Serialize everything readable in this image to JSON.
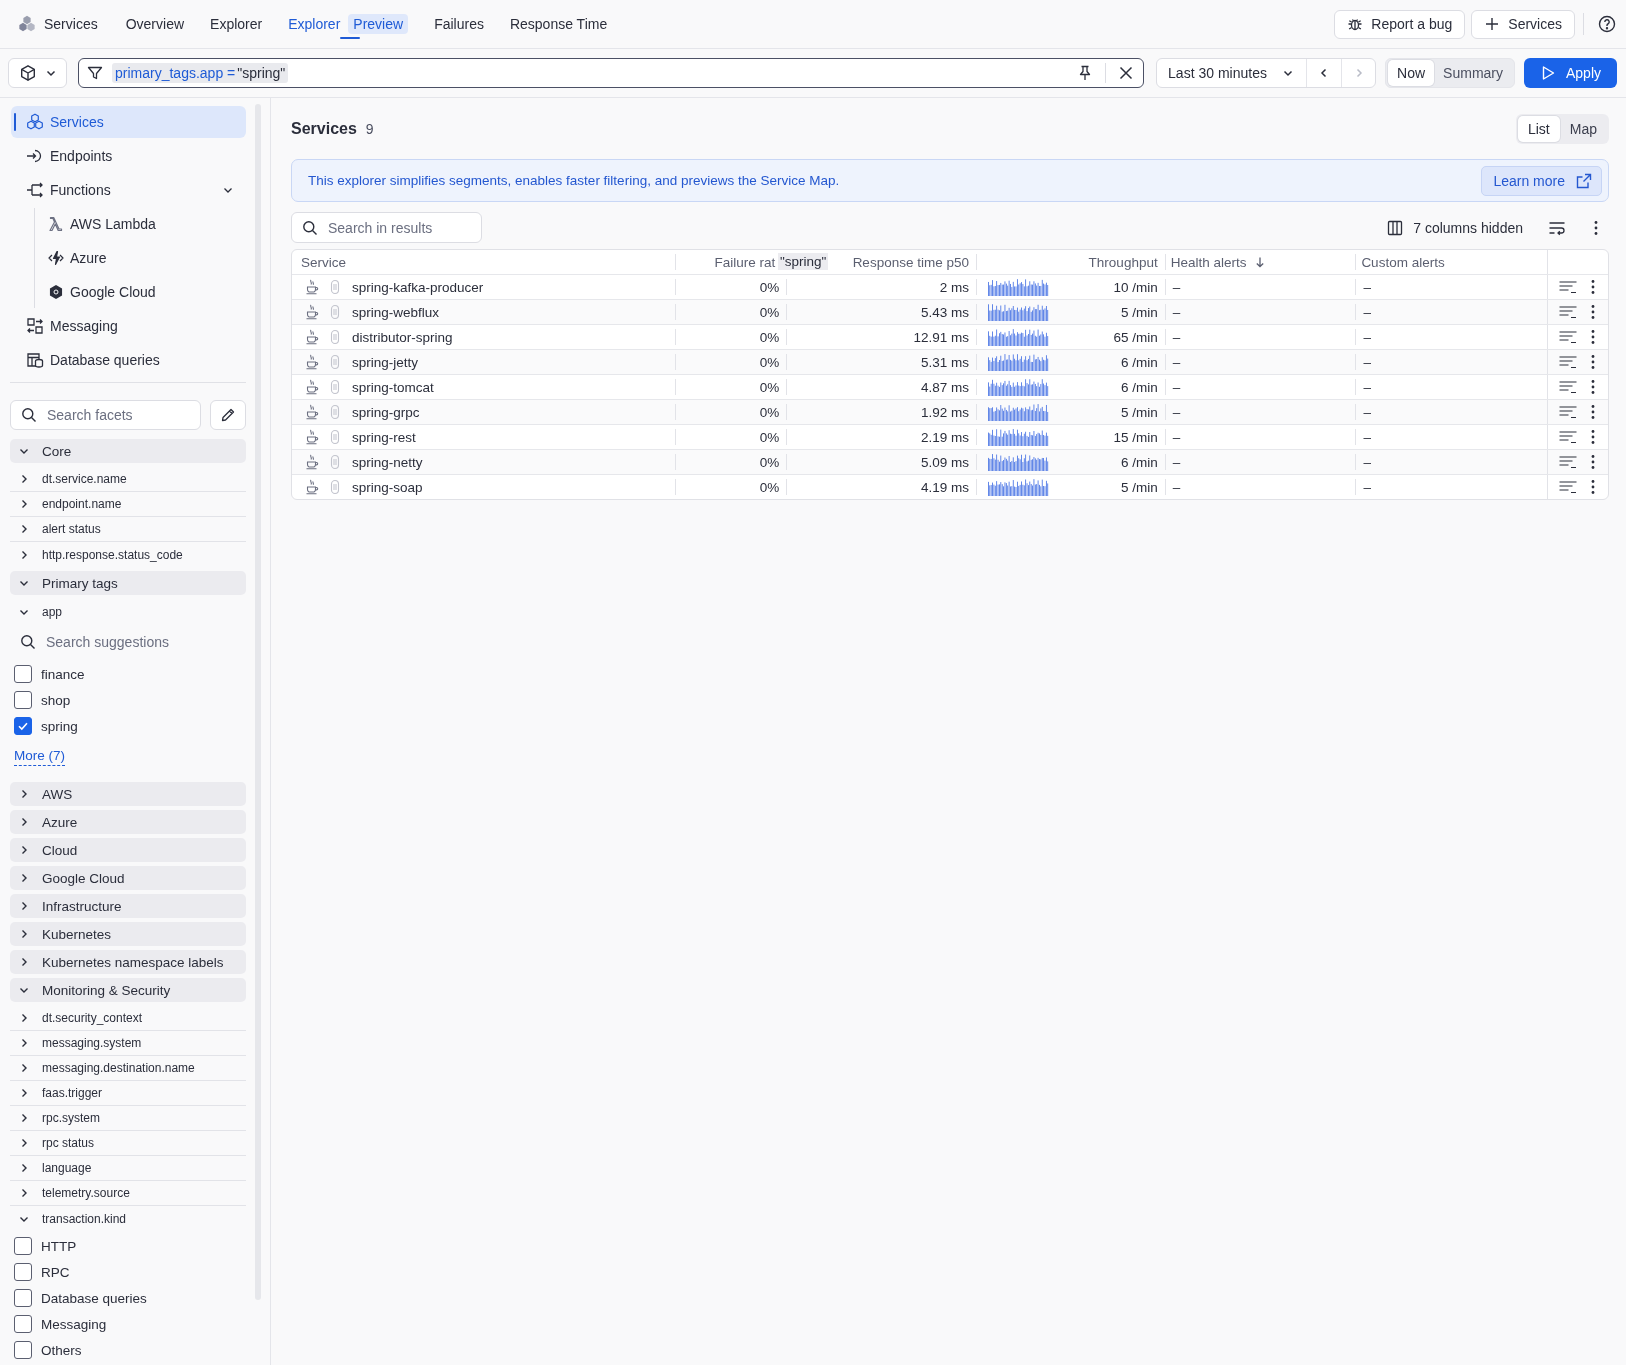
{
  "app_bar": {
    "app_name": "Services",
    "tabs": [
      {
        "label": "Overview",
        "selected": false
      },
      {
        "label": "Explorer",
        "selected": false
      },
      {
        "label": "Explorer",
        "badge": "Preview",
        "selected": true
      },
      {
        "label": "Failures",
        "selected": false
      },
      {
        "label": "Response Time",
        "selected": false
      }
    ],
    "actions": [
      {
        "label": "Report a bug"
      },
      {
        "label": "Services"
      }
    ]
  },
  "toolbar": {
    "filter": {
      "key": "primary_tags.app =",
      "value": "\"spring\""
    },
    "timeframe": "Last 30 minutes",
    "time_steps": [
      {
        "kind": "previous",
        "disabled": false
      },
      {
        "kind": "next",
        "disabled": true
      }
    ],
    "modes": [
      {
        "label": "Now",
        "selected": true
      },
      {
        "label": "Summary",
        "selected": false
      }
    ],
    "apply": "Apply"
  },
  "sidebar": {
    "nav": [
      {
        "label": "Services",
        "selected": true
      },
      {
        "label": "Endpoints",
        "selected": false
      },
      {
        "label": "Functions",
        "selected": false,
        "expanded": true,
        "children": [
          {
            "label": "AWS Lambda",
            "selected": false
          },
          {
            "label": "Azure",
            "selected": false
          },
          {
            "label": "Google Cloud",
            "selected": false
          }
        ]
      },
      {
        "label": "Messaging",
        "selected": false
      },
      {
        "label": "Database queries",
        "selected": false
      }
    ],
    "facet_search": {
      "placeholder": "Search facets"
    },
    "facet_groups": [
      {
        "label": "Core",
        "expanded": true,
        "facets": [
          {
            "label": "dt.service.name",
            "expanded": false
          },
          {
            "label": "endpoint.name",
            "expanded": false
          },
          {
            "label": "alert status",
            "expanded": false
          },
          {
            "label": "http.response.status_code",
            "expanded": false
          }
        ]
      },
      {
        "label": "Primary tags",
        "expanded": true,
        "facets": [
          {
            "label": "app",
            "expanded": true,
            "search": {
              "placeholder": "Search suggestions"
            },
            "options": [
              {
                "label": "finance",
                "checked": false
              },
              {
                "label": "shop",
                "checked": false
              },
              {
                "label": "spring",
                "checked": true
              }
            ],
            "more": "More (7)"
          }
        ]
      },
      {
        "label": "AWS",
        "expanded": false
      },
      {
        "label": "Azure",
        "expanded": false
      },
      {
        "label": "Cloud",
        "expanded": false
      },
      {
        "label": "Google Cloud",
        "expanded": false
      },
      {
        "label": "Infrastructure",
        "expanded": false
      },
      {
        "label": "Kubernetes",
        "expanded": false
      },
      {
        "label": "Kubernetes namespace labels",
        "expanded": false
      },
      {
        "label": "Monitoring & Security",
        "expanded": true,
        "facets": [
          {
            "label": "dt.security_context",
            "expanded": false
          },
          {
            "label": "messaging.system",
            "expanded": false
          },
          {
            "label": "messaging.destination.name",
            "expanded": false
          },
          {
            "label": "faas.trigger",
            "expanded": false
          },
          {
            "label": "rpc.system",
            "expanded": false
          },
          {
            "label": "rpc status",
            "expanded": false
          },
          {
            "label": "language",
            "expanded": false
          },
          {
            "label": "telemetry.source",
            "expanded": false
          },
          {
            "label": "transaction.kind",
            "expanded": true,
            "options": [
              {
                "label": "HTTP",
                "checked": false
              },
              {
                "label": "RPC",
                "checked": false
              },
              {
                "label": "Database queries",
                "checked": false
              },
              {
                "label": "Messaging",
                "checked": false
              },
              {
                "label": "Others",
                "checked": false
              }
            ]
          }
        ]
      }
    ]
  },
  "main": {
    "title": "Services",
    "count": "9",
    "views": [
      {
        "label": "List",
        "selected": true
      },
      {
        "label": "Map",
        "selected": false
      }
    ],
    "banner": {
      "text": "This explorer simplifies segments, enables faster filtering, and previews the Service Map.",
      "link": "Learn more"
    },
    "search": {
      "placeholder": "Search in results"
    },
    "hidden_columns": "7 columns hidden",
    "table": {
      "columns": [
        {
          "label": "Service",
          "sorted": false
        },
        {
          "label": "Failure rat",
          "sorted": false
        },
        {
          "label": "Response time p50",
          "sorted": false
        },
        {
          "label": "Throughput",
          "sorted": false
        },
        {
          "label": "Health alerts",
          "sorted": true
        },
        {
          "label": "Custom alerts",
          "sorted": false
        }
      ],
      "drag_label": "\"spring\"",
      "rows": [
        {
          "service": "spring-kafka-producer",
          "failure_rate": "0%",
          "response_time": "2 ms",
          "throughput": "10 /min",
          "health_alerts": "–",
          "custom_alerts": "–"
        },
        {
          "service": "spring-webflux",
          "failure_rate": "0%",
          "response_time": "5.43 ms",
          "throughput": "5 /min",
          "health_alerts": "–",
          "custom_alerts": "–"
        },
        {
          "service": "distributor-spring",
          "failure_rate": "0%",
          "response_time": "12.91 ms",
          "throughput": "65 /min",
          "health_alerts": "–",
          "custom_alerts": "–"
        },
        {
          "service": "spring-jetty",
          "failure_rate": "0%",
          "response_time": "5.31 ms",
          "throughput": "6 /min",
          "health_alerts": "–",
          "custom_alerts": "–"
        },
        {
          "service": "spring-tomcat",
          "failure_rate": "0%",
          "response_time": "4.87 ms",
          "throughput": "6 /min",
          "health_alerts": "–",
          "custom_alerts": "–"
        },
        {
          "service": "spring-grpc",
          "failure_rate": "0%",
          "response_time": "1.92 ms",
          "throughput": "5 /min",
          "health_alerts": "–",
          "custom_alerts": "–"
        },
        {
          "service": "spring-rest",
          "failure_rate": "0%",
          "response_time": "2.19 ms",
          "throughput": "15 /min",
          "health_alerts": "–",
          "custom_alerts": "–"
        },
        {
          "service": "spring-netty",
          "failure_rate": "0%",
          "response_time": "5.09 ms",
          "throughput": "6 /min",
          "health_alerts": "–",
          "custom_alerts": "–"
        },
        {
          "service": "spring-soap",
          "failure_rate": "0%",
          "response_time": "4.19 ms",
          "throughput": "5 /min",
          "health_alerts": "–",
          "custom_alerts": "–"
        }
      ]
    }
  }
}
